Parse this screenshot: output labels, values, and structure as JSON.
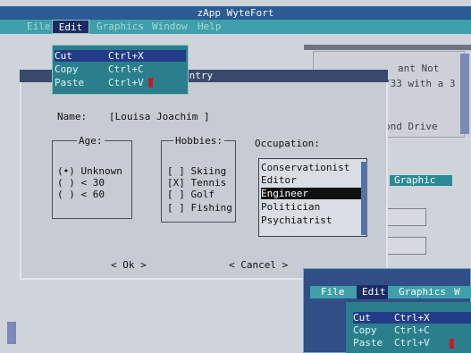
{
  "app": {
    "title": "zApp WyteFort"
  },
  "menubar": {
    "left_stub": "Eile",
    "edit": "Edit",
    "graphics": "Graphics",
    "window": "Window",
    "help": "Help"
  },
  "edit_menu": {
    "items": [
      {
        "label": "Cut",
        "shortcut": "Ctrl+X",
        "selected": true
      },
      {
        "label": "Copy",
        "shortcut": "Ctrl+C",
        "selected": false
      },
      {
        "label": "Paste",
        "shortcut": "Ctrl+V",
        "selected": false
      }
    ]
  },
  "dialog": {
    "title": "Entry",
    "name_label": "Name:",
    "name_value": "[Louisa Joachim          ]",
    "age_legend": "Age:",
    "age_options": [
      "(•) Unknown",
      "( ) < 30",
      "( ) < 60"
    ],
    "hobbies_legend": "Hobbies:",
    "hobbies_options": [
      "[ ] Skiing",
      "[X] Tennis",
      "[ ] Golf",
      "[ ] Fishing"
    ],
    "occupation_label": "Occupation:",
    "occupations": [
      "Conservationist",
      "Editor",
      "Engineer",
      "Politician",
      "Psychiatrist"
    ],
    "selected_occupation_index": 2,
    "ok_label": "< Ok >",
    "cancel_label": "< Cancel >"
  },
  "background_text": {
    "line1": "ant Not",
    "line2": "/33 with a 3",
    "line3": "ond Drive",
    "graphic_tab": "Graphic"
  },
  "bottom_right": {
    "menubar": {
      "file": "File",
      "edit": "Edit",
      "graphics": "Graphics",
      "window": "W"
    },
    "items": [
      {
        "label": "Cut",
        "shortcut": "Ctrl+X",
        "selected": true
      },
      {
        "label": "Copy",
        "shortcut": "Ctrl+C",
        "selected": false
      },
      {
        "label": "Paste",
        "shortcut": "Ctrl+V",
        "selected": false
      }
    ]
  }
}
